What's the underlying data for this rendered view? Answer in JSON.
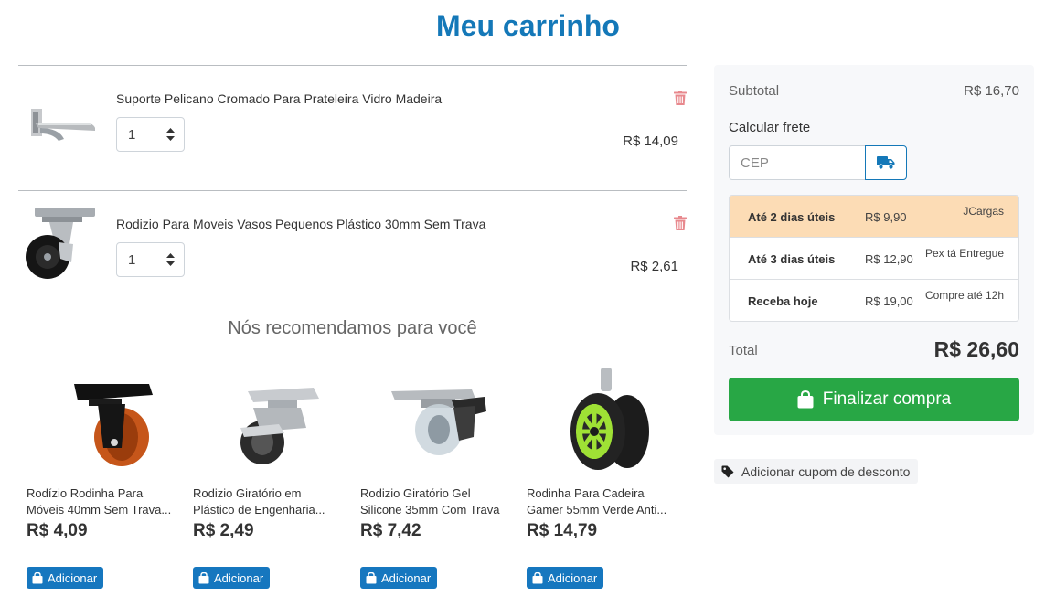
{
  "header": {
    "title": "Meu carrinho"
  },
  "cart": {
    "items": [
      {
        "name": "Suporte Pelicano Cromado Para Prateleira Vidro Madeira",
        "quantity": "1",
        "price": "R$ 14,09"
      },
      {
        "name": "Rodizio Para Moveis Vasos Pequenos Plástico 30mm Sem Trava",
        "quantity": "1",
        "price": "R$ 2,61"
      }
    ]
  },
  "recommendations": {
    "title": "Nós recomendamos para você",
    "add_label": "Adicionar",
    "products": [
      {
        "name_line1": "Rodízio Rodinha Para",
        "name_line2": "Móveis 40mm Sem Trava...",
        "price": "R$ 4,09"
      },
      {
        "name_line1": "Rodizio Giratório em",
        "name_line2": "Plástico de Engenharia...",
        "price": "R$ 2,49"
      },
      {
        "name_line1": "Rodizio Giratório Gel",
        "name_line2": "Silicone 35mm Com Trava",
        "price": "R$ 7,42"
      },
      {
        "name_line1": "Rodinha Para Cadeira",
        "name_line2": "Gamer 55mm Verde Anti...",
        "price": "R$ 14,79"
      }
    ]
  },
  "summary": {
    "subtotal_label": "Subtotal",
    "subtotal_value": "R$ 16,70",
    "shipping_label": "Calcular frete",
    "cep_placeholder": "CEP",
    "shipping_options": [
      {
        "days": "Até 2 dias úteis",
        "price": "R$ 9,90",
        "carrier": "JCargas",
        "selected": true
      },
      {
        "days": "Até 3 dias úteis",
        "price": "R$ 12,90",
        "carrier": "Pex tá Entregue",
        "selected": false
      },
      {
        "days": "Receba hoje",
        "price": "R$ 19,00",
        "carrier": "Compre até 12h",
        "selected": false
      }
    ],
    "total_label": "Total",
    "total_value": "R$ 26,60",
    "checkout_label": "Finalizar compra"
  },
  "coupon": {
    "label": "Adicionar cupom de desconto"
  },
  "colors": {
    "brand": "#1478b8",
    "checkout": "#28a745",
    "selected_shipping": "#fcdcb5",
    "trash": "#e8898e"
  }
}
